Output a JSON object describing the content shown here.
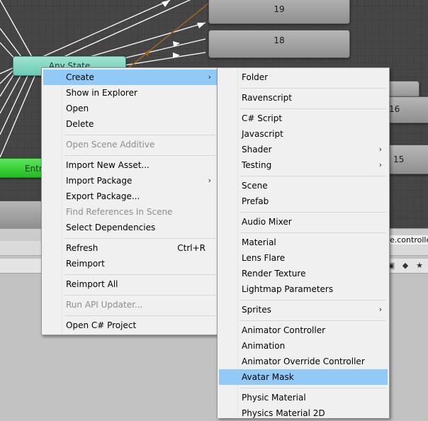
{
  "graph": {
    "states": {
      "s19": "19",
      "s18": "18",
      "any_state": "Any State",
      "entry": "Entry",
      "s16": "16",
      "s15": "15"
    },
    "colors": {
      "background": "#464646",
      "any_state": "#7fd6c1",
      "entry": "#33cc33",
      "state": "#a3a3a3",
      "transition": "#ffffff",
      "selected_transition": "#a0641e"
    }
  },
  "panel": {
    "controller_label": "e.controller",
    "toolbar_icons": [
      "lock-icon",
      "tag-icon",
      "star-icon"
    ]
  },
  "menu": {
    "items": [
      {
        "label": "Create",
        "submenu": true,
        "highlighted": true
      },
      {
        "label": "Show in Explorer"
      },
      {
        "label": "Open"
      },
      {
        "label": "Delete"
      },
      {
        "label": "Open Scene Additive",
        "disabled": true
      },
      {
        "label": "Import New Asset..."
      },
      {
        "label": "Import Package",
        "submenu": true
      },
      {
        "label": "Export Package..."
      },
      {
        "label": "Find References In Scene",
        "disabled": true
      },
      {
        "label": "Select Dependencies"
      },
      {
        "label": "Refresh",
        "shortcut": "Ctrl+R"
      },
      {
        "label": "Reimport"
      },
      {
        "label": "Reimport All"
      },
      {
        "label": "Run API Updater...",
        "disabled": true
      },
      {
        "label": "Open C# Project"
      }
    ],
    "arrow_glyph": "›"
  },
  "submenu": {
    "items": [
      {
        "label": "Folder"
      },
      {
        "label": "Ravenscript"
      },
      {
        "label": "C# Script"
      },
      {
        "label": "Javascript"
      },
      {
        "label": "Shader",
        "submenu": true
      },
      {
        "label": "Testing",
        "submenu": true
      },
      {
        "label": "Scene"
      },
      {
        "label": "Prefab"
      },
      {
        "label": "Audio Mixer"
      },
      {
        "label": "Material"
      },
      {
        "label": "Lens Flare"
      },
      {
        "label": "Render Texture"
      },
      {
        "label": "Lightmap Parameters"
      },
      {
        "label": "Sprites",
        "submenu": true
      },
      {
        "label": "Animator Controller"
      },
      {
        "label": "Animation"
      },
      {
        "label": "Animator Override Controller"
      },
      {
        "label": "Avatar Mask",
        "highlighted": true
      },
      {
        "label": "Physic Material"
      },
      {
        "label": "Physics Material 2D"
      }
    ]
  }
}
